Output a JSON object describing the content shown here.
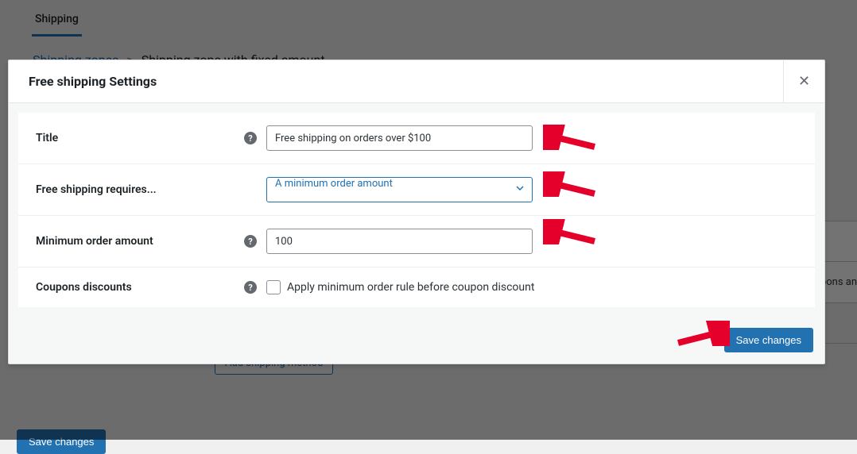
{
  "page": {
    "tab": "Shipping",
    "breadcrumb_link": "Shipping zones",
    "breadcrumb_current": "Shipping zone with fixed amount",
    "add_method_btn": "Add shipping method",
    "save_btn": "Save changes",
    "bg_row_text": "pons an"
  },
  "modal": {
    "title": "Free shipping Settings",
    "fields": {
      "title_label": "Title",
      "title_value": "Free shipping on orders over $100",
      "requires_label": "Free shipping requires...",
      "requires_value": "A minimum order amount",
      "min_amount_label": "Minimum order amount",
      "min_amount_value": "100",
      "coupons_label": "Coupons discounts",
      "coupons_checkbox_label": "Apply minimum order rule before coupon discount"
    },
    "save_btn": "Save changes"
  }
}
